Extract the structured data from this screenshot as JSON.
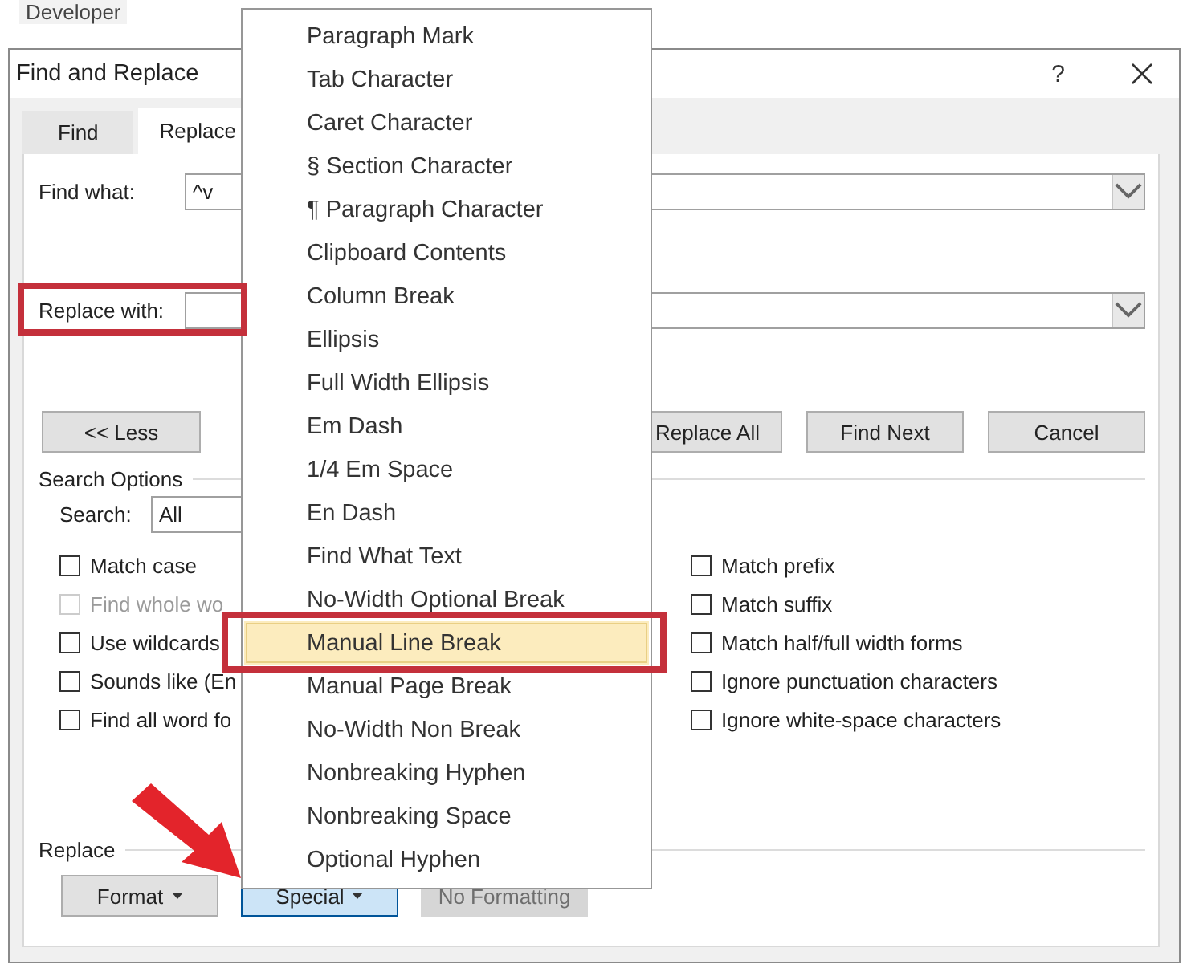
{
  "background": {
    "ribbon_tab": "Developer"
  },
  "window": {
    "title": "Find and Replace",
    "help": "?"
  },
  "tabs": [
    {
      "label": "Find",
      "selected": false
    },
    {
      "label": "Replace",
      "selected": true
    }
  ],
  "find_what": {
    "label": "Find what:",
    "value": "^v"
  },
  "replace_with": {
    "label": "Replace with:",
    "annotated": true
  },
  "less_button": "<< Less",
  "action_buttons": [
    "Replace All",
    "Find Next",
    "Cancel"
  ],
  "search_options": {
    "heading": "Search Options",
    "search_label": "Search:",
    "search_value": "All",
    "left_options": [
      {
        "label": "Match case",
        "checked": false,
        "disabled": false
      },
      {
        "label": "Find whole wo",
        "checked": false,
        "disabled": true
      },
      {
        "label": "Use wildcards",
        "checked": false,
        "disabled": false
      },
      {
        "label": "Sounds like (En",
        "checked": false,
        "disabled": false
      },
      {
        "label": "Find all word fo",
        "checked": false,
        "disabled": false
      }
    ],
    "right_options": [
      {
        "label": "Match prefix",
        "checked": false,
        "disabled": false
      },
      {
        "label": "Match suffix",
        "checked": false,
        "disabled": false
      },
      {
        "label": "Match half/full width forms",
        "checked": false,
        "disabled": false
      },
      {
        "label": "Ignore punctuation characters",
        "checked": false,
        "disabled": false
      },
      {
        "label": "Ignore white-space characters",
        "checked": false,
        "disabled": false
      }
    ]
  },
  "replace_section": {
    "heading": "Replace",
    "buttons": [
      {
        "label": "Format",
        "dropdown": true,
        "selected": false,
        "disabled": false
      },
      {
        "label": "Special",
        "dropdown": true,
        "selected": true,
        "disabled": false
      },
      {
        "label": "No Formatting",
        "dropdown": false,
        "selected": false,
        "disabled": true
      }
    ]
  },
  "pointer_arrow": true,
  "special_menu": {
    "items": [
      {
        "label": "Paragraph Mark",
        "selected": false,
        "annotated": false
      },
      {
        "label": "Tab Character",
        "selected": false,
        "annotated": false
      },
      {
        "label": "Caret Character",
        "selected": false,
        "annotated": false
      },
      {
        "label": "§ Section Character",
        "selected": false,
        "annotated": false
      },
      {
        "label": "¶ Paragraph Character",
        "selected": false,
        "annotated": false
      },
      {
        "label": "Clipboard Contents",
        "selected": false,
        "annotated": false
      },
      {
        "label": "Column Break",
        "selected": false,
        "annotated": false
      },
      {
        "label": "Ellipsis",
        "selected": false,
        "annotated": false
      },
      {
        "label": "Full Width Ellipsis",
        "selected": false,
        "annotated": false
      },
      {
        "label": "Em Dash",
        "selected": false,
        "annotated": false
      },
      {
        "label": "1/4 Em Space",
        "selected": false,
        "annotated": false
      },
      {
        "label": "En Dash",
        "selected": false,
        "annotated": false
      },
      {
        "label": "Find What Text",
        "selected": false,
        "annotated": false
      },
      {
        "label": "No-Width Optional Break",
        "selected": false,
        "annotated": false
      },
      {
        "label": "Manual Line Break",
        "selected": true,
        "annotated": true
      },
      {
        "label": "Manual Page Break",
        "selected": false,
        "annotated": false
      },
      {
        "label": "No-Width Non Break",
        "selected": false,
        "annotated": false
      },
      {
        "label": "Nonbreaking Hyphen",
        "selected": false,
        "annotated": false
      },
      {
        "label": "Nonbreaking Space",
        "selected": false,
        "annotated": false
      },
      {
        "label": "Optional Hyphen",
        "selected": false,
        "annotated": false
      }
    ]
  }
}
